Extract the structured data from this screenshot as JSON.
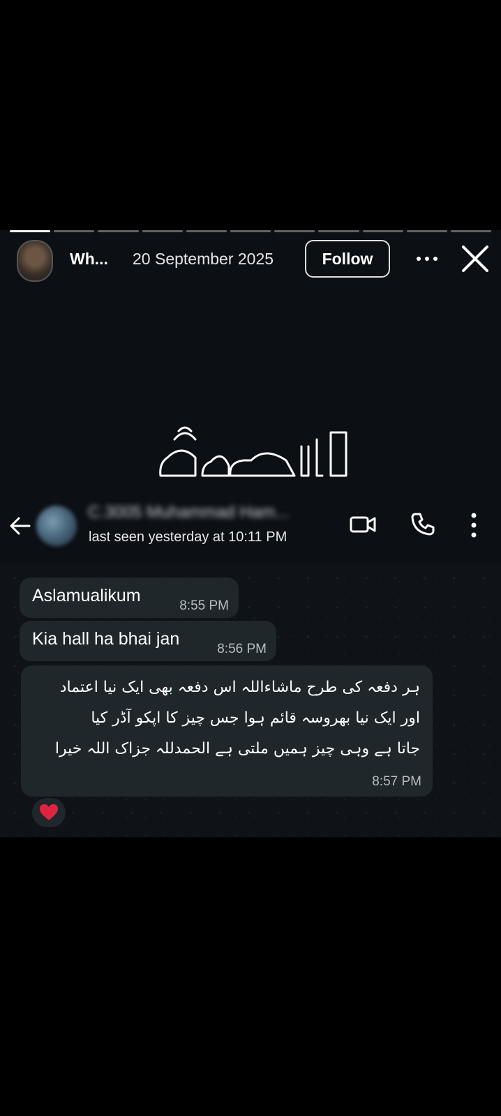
{
  "story": {
    "username": "Wh...",
    "date": "20 September 2025",
    "follow_label": "Follow",
    "segments": 11,
    "active_segment_progress": 1
  },
  "whatsapp": {
    "contact_name": "C.3005 Muhammad Ham...",
    "last_seen": "last seen yesterday at 10:11 PM",
    "messages": [
      {
        "text": "Aslamualikum",
        "time": "8:55 PM"
      },
      {
        "text": "Kia hall ha bhai jan",
        "time": "8:56 PM"
      },
      {
        "lines": [
          "ہر دفعہ کی طرح ماشاءاللہ اس دفعہ بھی ایک نیا اعتماد",
          "اور ایک نیا بھروسہ قائم ہوا جس چیز کا اپکو آڈر کیا",
          "جاتا ہے وہی چیز ہمیں ملتی ہے الحمدللہ جزاک اللہ خیرا"
        ],
        "time": "8:57 PM"
      }
    ],
    "reaction": "heart-emoji"
  },
  "colors": {
    "story_bg": "#0c0f14",
    "bubble_bg": "#1f272a",
    "heart": "#e0243f"
  }
}
